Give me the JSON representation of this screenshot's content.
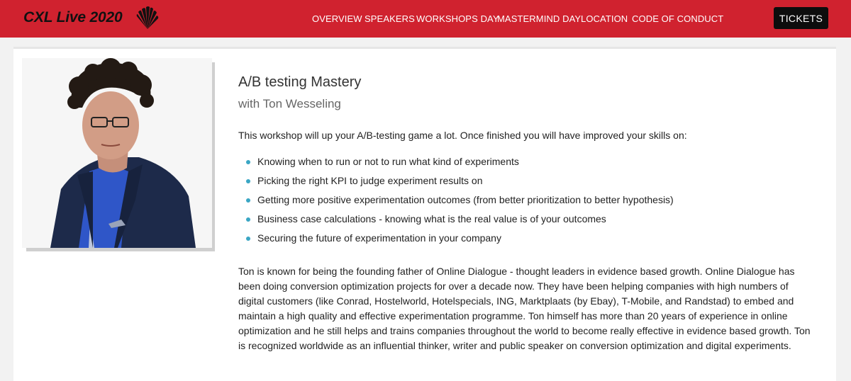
{
  "header": {
    "logo_text": "CXL Live 2020",
    "nav": [
      "OVERVIEW",
      "SPEAKERS",
      "WORKSHOPS DAY",
      "MASTERMIND DAY",
      "LOCATION",
      "CODE OF CONDUCT"
    ],
    "tickets_label": "TICKETS"
  },
  "colors": {
    "brand_red": "#d0222f",
    "bullet_blue": "#3aa6c4",
    "button_dark": "#0d0d0d"
  },
  "workshop": {
    "title": "A/B testing Mastery",
    "subtitle": "with Ton Wesseling",
    "intro": "This workshop will up your A/B-testing game a lot. Once finished you will have improved your skills on:",
    "bullets": [
      "Knowing when to run or not to run what kind of experiments",
      "Picking the right KPI to judge experiment results on",
      "Getting more positive experimentation outcomes (from better prioritization to better hypothesis)",
      "Business case calculations - knowing what is the real value is of your outcomes",
      "Securing the future of experimentation in your company"
    ],
    "bio": "Ton is known for being the founding father of Online Dialogue - thought leaders in evidence based growth. Online Dialogue has been doing conversion optimization projects for over a decade now. They have been helping companies with high numbers of digital customers (like Conrad, Hostelworld, Hotelspecials, ING, Marktplaats (by Ebay), T-Mobile, and Randstad) to embed and maintain a high quality and effective experimentation programme. Ton himself has more than 20 years of experience in online optimization and he still helps and trains companies throughout the world to become really effective in evidence based growth. Ton is recognized worldwide as an influential thinker, writer and public speaker on conversion optimization and digital experiments."
  }
}
